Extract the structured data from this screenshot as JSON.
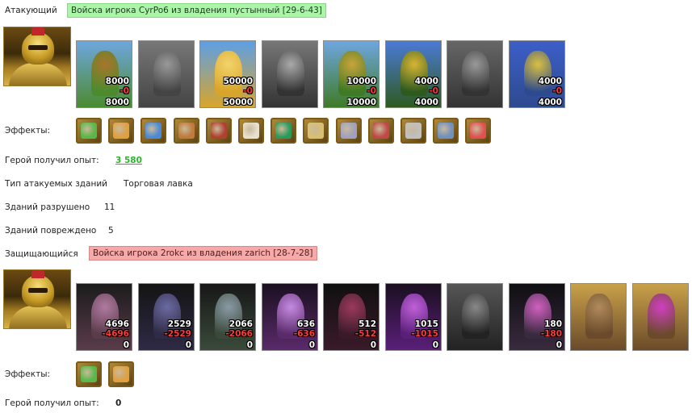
{
  "attacker": {
    "label": "Атакующий",
    "banner": "Войска игрока CyrPo6 из владения пустынный [29-6-43]",
    "hero_portrait": "golden-knight-hero",
    "units": [
      {
        "name": "crossbow-cavalry",
        "count": "8000",
        "loss": "-0",
        "remaining": "8000",
        "active": true
      },
      {
        "name": "stone-golem",
        "count": "",
        "loss": "",
        "remaining": "",
        "active": false
      },
      {
        "name": "golden-cavalry",
        "count": "50000",
        "loss": "-0",
        "remaining": "50000",
        "active": true
      },
      {
        "name": "pegasus-rider",
        "count": "",
        "loss": "",
        "remaining": "",
        "active": false
      },
      {
        "name": "crossbowman",
        "count": "10000",
        "loss": "-0",
        "remaining": "10000",
        "active": true
      },
      {
        "name": "hooded-mage",
        "count": "4000",
        "loss": "-0",
        "remaining": "4000",
        "active": true
      },
      {
        "name": "armored-warrior",
        "count": "",
        "loss": "",
        "remaining": "",
        "active": false
      },
      {
        "name": "archmage",
        "count": "4000",
        "loss": "-0",
        "remaining": "4000",
        "active": true
      }
    ],
    "effects_label": "Эффекты:",
    "effects": [
      "sword-icon",
      "handshake-icon",
      "hand-shield-icon",
      "gears-icon",
      "chest-icon",
      "dice-icon",
      "shield-icon",
      "scroll-hand-icon",
      "web-icon",
      "helmet-icon",
      "blade-icon",
      "cage-icon",
      "heart-icon"
    ],
    "exp_label": "Герой получил опыт:",
    "exp_value": "3 580",
    "target_type_label": "Тип атакуемых зданий",
    "target_type_value": "Торговая лавка",
    "destroyed_label": "Зданий разрушено",
    "destroyed_value": "11",
    "damaged_label": "Зданий повреждено",
    "damaged_value": "5"
  },
  "defender": {
    "label": "Защищающийся",
    "banner": "Войска игрока 2rokc из владения zarich [28-7-28]",
    "hero_portrait": "golden-knight-hero",
    "units": [
      {
        "name": "purple-brute",
        "count": "4696",
        "loss": "-4696",
        "remaining": "0",
        "active": true
      },
      {
        "name": "dark-assassin",
        "count": "2529",
        "loss": "-2529",
        "remaining": "0",
        "active": true
      },
      {
        "name": "lizard-knight",
        "count": "2066",
        "loss": "-2066",
        "remaining": "0",
        "active": true
      },
      {
        "name": "harpy",
        "count": "636",
        "loss": "-636",
        "remaining": "0",
        "active": true
      },
      {
        "name": "dark-archer",
        "count": "512",
        "loss": "-512",
        "remaining": "0",
        "active": true
      },
      {
        "name": "sorceress",
        "count": "1015",
        "loss": "-1015",
        "remaining": "0",
        "active": true
      },
      {
        "name": "shadow-warrior",
        "count": "",
        "loss": "",
        "remaining": "",
        "active": false
      },
      {
        "name": "spider-demon",
        "count": "180",
        "loss": "-180",
        "remaining": "0",
        "active": true
      },
      {
        "name": "war-beast",
        "count": "",
        "loss": "",
        "remaining": "",
        "active": true
      },
      {
        "name": "crystal-orb-machine",
        "count": "",
        "loss": "",
        "remaining": "",
        "active": true
      }
    ],
    "effects_label": "Эффекты:",
    "effects": [
      "sword-icon",
      "handshake-icon"
    ],
    "exp_label": "Герой получил опыт:",
    "exp_value": "0"
  },
  "colors": {
    "attacker_banner": "#aaf5a8",
    "defender_banner": "#f7a8a8",
    "exp_link": "#2bb52b",
    "loss": "#ff3a3a"
  }
}
